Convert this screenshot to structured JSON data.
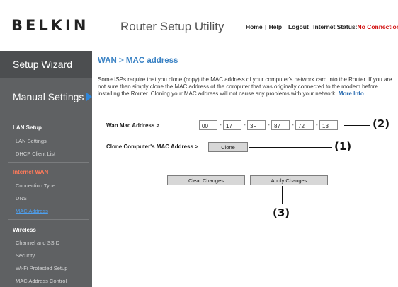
{
  "header": {
    "logo": "BELKIN",
    "logo_mark": ".",
    "app_title": "Router Setup Utility",
    "links": {
      "home": "Home",
      "help": "Help",
      "logout": "Logout",
      "sep": "|"
    },
    "internet_status_label": "Internet Status:",
    "internet_status_value": "No Connection"
  },
  "sidebar": {
    "setup_wizard": "Setup Wizard",
    "manual_settings": "Manual Settings",
    "lan_setup": {
      "title": "LAN Setup",
      "items": [
        "LAN Settings",
        "DHCP Client List"
      ]
    },
    "internet_wan": {
      "title": "Internet WAN",
      "items": [
        "Connection Type",
        "DNS",
        "MAC Address"
      ]
    },
    "wireless": {
      "title": "Wireless",
      "items": [
        "Channel and SSID",
        "Security",
        "Wi-Fi Protected Setup",
        "MAC Address Control"
      ]
    }
  },
  "main": {
    "heading": "WAN > MAC address",
    "intro": "Some ISPs require that you clone (copy) the MAC address of your computer's network card into the Router. If you are not sure then simply clone the MAC address of the computer that was originally connected to the modem before installing the Router. Cloning your MAC address will not cause any problems with your network.",
    "more_info": "More Info",
    "wan_mac_label": "Wan Mac Address >",
    "mac_octets": [
      "00",
      "17",
      "3F",
      "87",
      "72",
      "13"
    ],
    "mac_sep": "-",
    "clone_label": "Clone Computer's MAC Address >",
    "clone_button": "Clone",
    "clear_button": "Clear Changes",
    "apply_button": "Apply Changes"
  },
  "callouts": {
    "c1": "(1)",
    "c2": "(2)",
    "c3": "(3)"
  }
}
